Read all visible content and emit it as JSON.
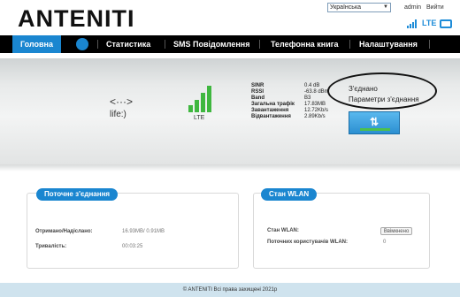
{
  "header": {
    "brand": "ANTENITI",
    "language": "Українська",
    "user": "admin",
    "logout": "Вийти",
    "network_type": "LTE"
  },
  "nav": {
    "items": [
      {
        "label": "Головна"
      },
      {
        "label": "Статистика"
      },
      {
        "label": "SMS Повідомлення"
      },
      {
        "label": "Телефонна книга"
      },
      {
        "label": "Налаштування"
      }
    ],
    "phone_badge": "☎"
  },
  "status": {
    "life_code": "<···>",
    "life_label": "life:)",
    "lte_label": "LTE",
    "metrics": [
      {
        "name": "SINR",
        "value": "0.4 dB"
      },
      {
        "name": "RSSI",
        "value": "-63.8 dBm"
      },
      {
        "name": "Band",
        "value": "B3"
      },
      {
        "name": "Загальна трафік",
        "value": "17.83MB"
      },
      {
        "name": "Завантаження",
        "value": "12.72Kb/s"
      },
      {
        "name": "Відвантаження",
        "value": "2.89Kb/s"
      }
    ],
    "connection_state": "З'єднано",
    "connection_params": "Параметри з'єднання"
  },
  "current_connection": {
    "title": "Поточне з'єднання",
    "rx_tx_label": "Отримано/Надіслано:",
    "rx_tx_value": "16.93MB/ 0.91MB",
    "duration_label": "Тривалість:",
    "duration_value": "00:03:25"
  },
  "wlan": {
    "title": "Стан WLAN",
    "state_label": "Стан WLAN:",
    "state_value": "Ввімкнено",
    "users_label": "Поточних користувачів WLAN:",
    "users_value": "0"
  },
  "footer": {
    "text": "© ANTENITI Всі права захищені 2021р"
  },
  "colors": {
    "accent": "#1a86d0",
    "signal": "#3fb73f",
    "nav_bg": "#000000"
  }
}
